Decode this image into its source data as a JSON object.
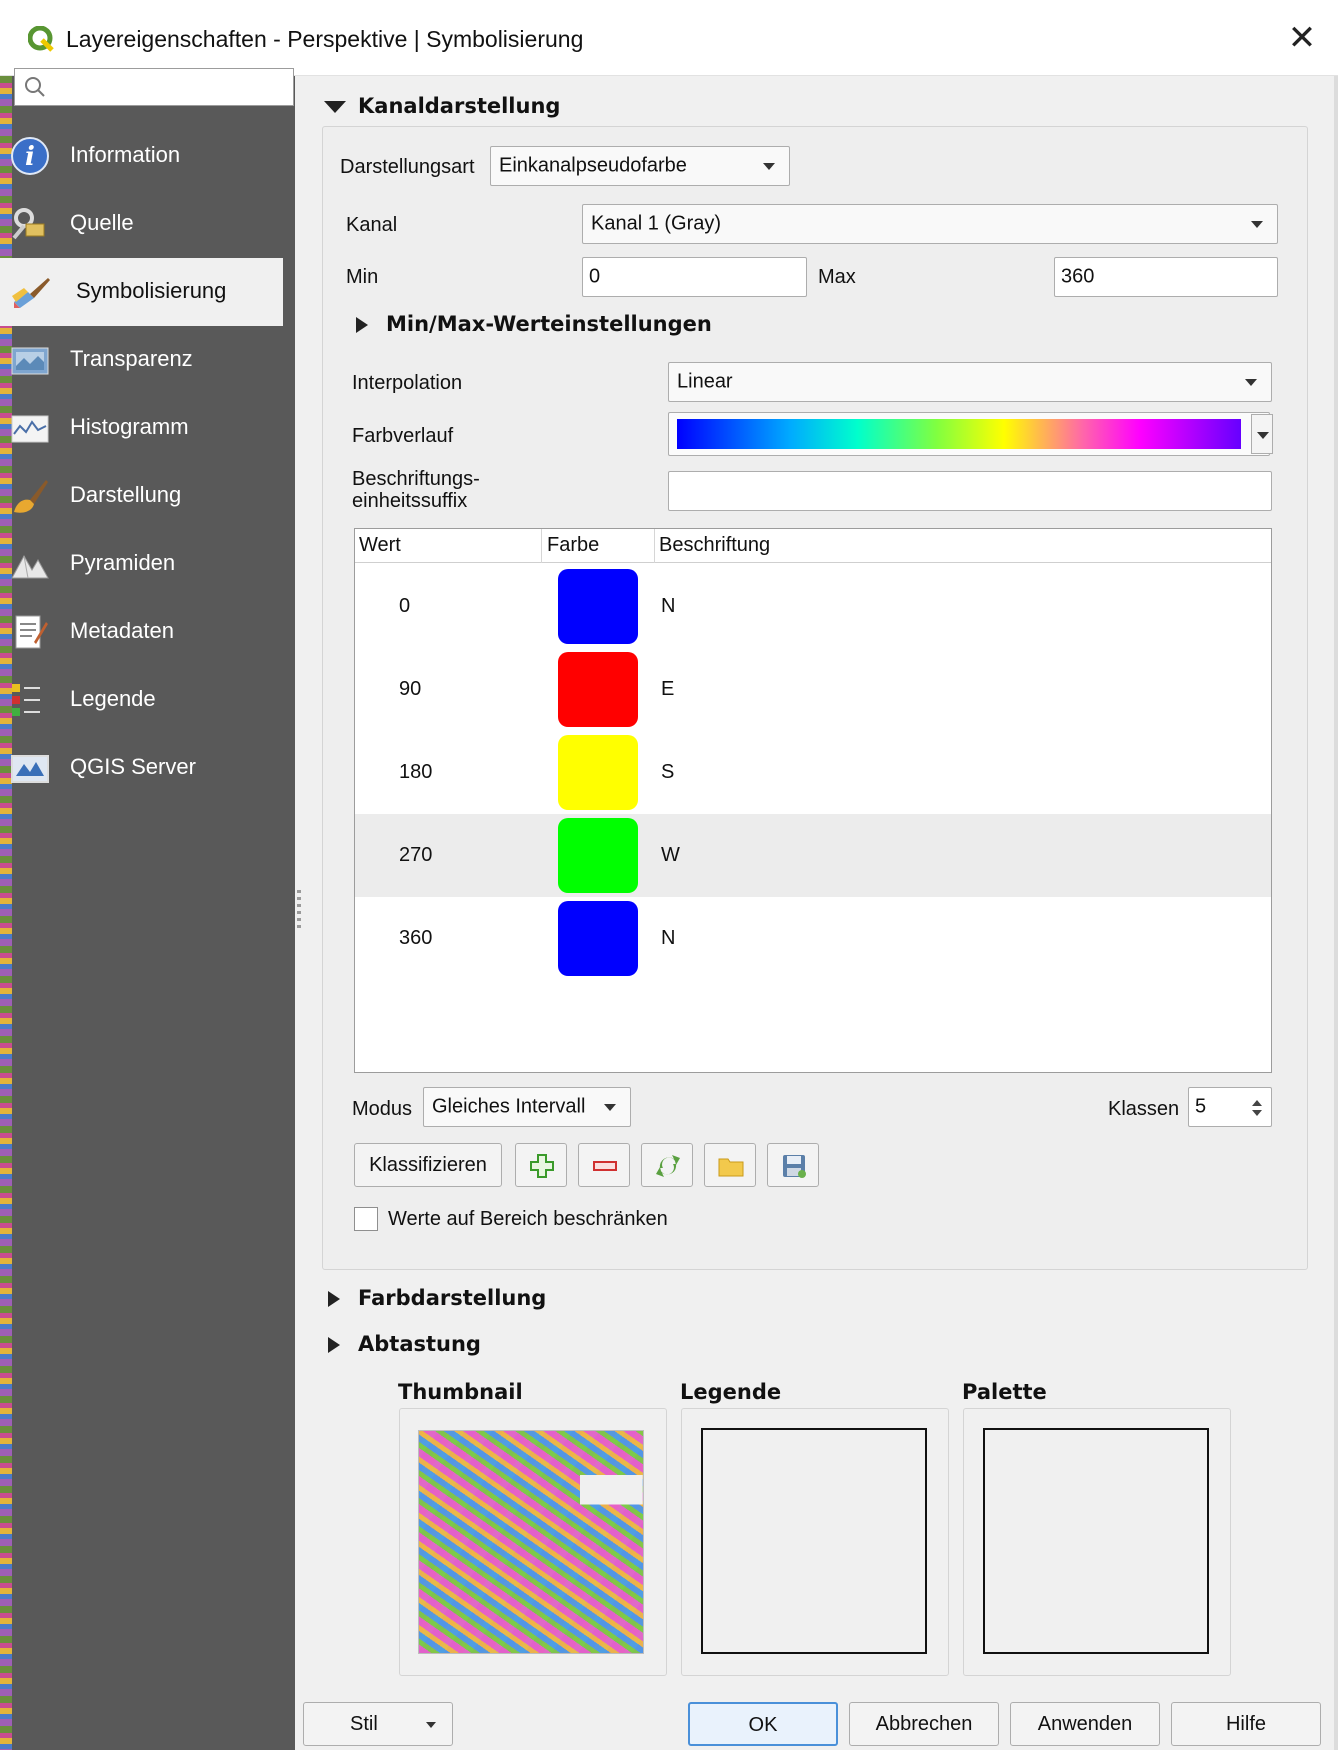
{
  "window": {
    "title": "Layereigenschaften - Perspektive | Symbolisierung",
    "close_glyph": "✕"
  },
  "sidebar": {
    "search_placeholder": "",
    "items": [
      {
        "label": "Information",
        "icon": "info-icon"
      },
      {
        "label": "Quelle",
        "icon": "source-icon"
      },
      {
        "label": "Symbolisierung",
        "icon": "paintbrush-icon",
        "active": true
      },
      {
        "label": "Transparenz",
        "icon": "transparency-icon"
      },
      {
        "label": "Histogramm",
        "icon": "histogram-icon"
      },
      {
        "label": "Darstellung",
        "icon": "rendering-brush-icon"
      },
      {
        "label": "Pyramiden",
        "icon": "pyramids-icon"
      },
      {
        "label": "Metadaten",
        "icon": "metadata-icon"
      },
      {
        "label": "Legende",
        "icon": "legend-icon"
      },
      {
        "label": "QGIS Server",
        "icon": "server-icon"
      }
    ]
  },
  "band_rendering": {
    "header": "Kanaldarstellung",
    "render_type_label": "Darstellungsart",
    "render_type_value": "Einkanalpseudofarbe",
    "band_label": "Kanal",
    "band_value": "Kanal 1 (Gray)",
    "min_label": "Min",
    "min_value": "0",
    "max_label": "Max",
    "max_value": "360",
    "minmax_header": "Min/Max-Werteinstellungen",
    "interpolation_label": "Interpolation",
    "interpolation_value": "Linear",
    "color_ramp_label": "Farbverlauf",
    "suffix_label_line1": "Beschriftungs-",
    "suffix_label_line2": "einheitssuffix",
    "suffix_value": "",
    "table": {
      "headers": [
        "Wert",
        "Farbe",
        "Beschriftung"
      ],
      "rows": [
        {
          "value": "0",
          "color": "#0000ff",
          "label": "N"
        },
        {
          "value": "90",
          "color": "#ff0000",
          "label": "E"
        },
        {
          "value": "180",
          "color": "#ffff00",
          "label": "S"
        },
        {
          "value": "270",
          "color": "#00ff00",
          "label": "W"
        },
        {
          "value": "360",
          "color": "#0000ff",
          "label": "N"
        }
      ]
    },
    "mode_label": "Modus",
    "mode_value": "Gleiches Intervall",
    "classes_label": "Klassen",
    "classes_value": "5",
    "classify_button": "Klassifizieren",
    "clip_checkbox_label": "Werte auf Bereich beschränken"
  },
  "color_rendering_header": "Farbdarstellung",
  "resampling_header": "Abtastung",
  "previews": {
    "thumbnail_title": "Thumbnail",
    "legend_title": "Legende",
    "palette_title": "Palette"
  },
  "footer": {
    "style_button": "Stil",
    "ok_button": "OK",
    "cancel_button": "Abbrechen",
    "apply_button": "Anwenden",
    "help_button": "Hilfe"
  }
}
